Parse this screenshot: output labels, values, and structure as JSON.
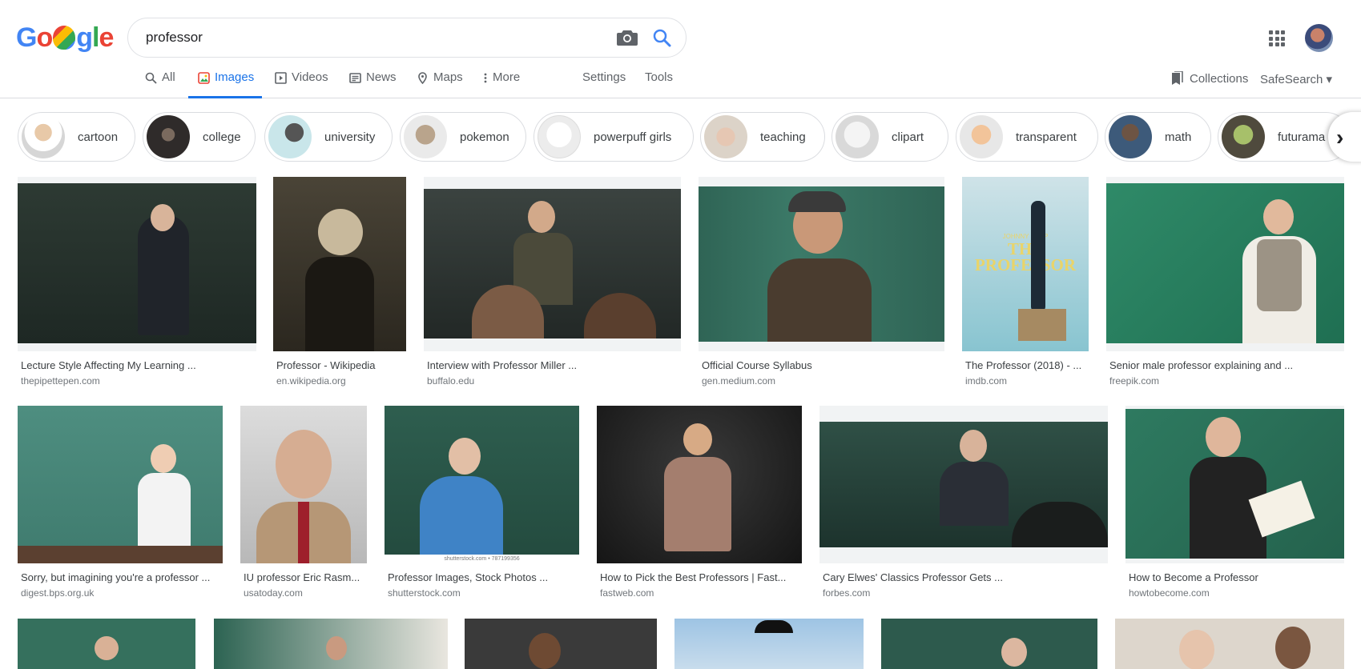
{
  "search": {
    "query": "professor"
  },
  "logo": {
    "letters": [
      "G",
      "o",
      "o",
      "g",
      "l",
      "e"
    ]
  },
  "tabs": {
    "all": "All",
    "images": "Images",
    "videos": "Videos",
    "news": "News",
    "maps": "Maps",
    "more": "More",
    "settings": "Settings",
    "tools": "Tools"
  },
  "header_right": {
    "collections": "Collections",
    "safesearch": "SafeSearch ▾"
  },
  "chips": [
    "cartoon",
    "college",
    "university",
    "pokemon",
    "powerpuff girls",
    "teaching",
    "clipart",
    "transparent",
    "math",
    "futurama"
  ],
  "results": [
    {
      "title": "Lecture Style Affecting My Learning ...",
      "source": "thepipettepen.com"
    },
    {
      "title": "Professor - Wikipedia",
      "source": "en.wikipedia.org"
    },
    {
      "title": "Interview with Professor Miller ...",
      "source": "buffalo.edu"
    },
    {
      "title": "Official Course Syllabus",
      "source": "gen.medium.com"
    },
    {
      "title": "The Professor (2018) - ...",
      "source": "imdb.com"
    },
    {
      "title": "Senior male professor explaining and ...",
      "source": "freepik.com"
    },
    {
      "title": "Sorry, but imagining you're a professor ...",
      "source": "digest.bps.org.uk"
    },
    {
      "title": "IU professor Eric Rasm...",
      "source": "usatoday.com"
    },
    {
      "title": "Professor Images, Stock Photos ...",
      "source": "shutterstock.com"
    },
    {
      "title": "How to Pick the Best Professors | Fast...",
      "source": "fastweb.com"
    },
    {
      "title": "Cary Elwes' Classics Professor Gets ...",
      "source": "forbes.com"
    },
    {
      "title": "How to Become a Professor",
      "source": "howtobecome.com"
    }
  ],
  "image_captions": {
    "poster": "THE PROFESSOR",
    "poster_actor": "JOHNNY DEPP",
    "watermark": "shutterstock.com • 787199356"
  }
}
